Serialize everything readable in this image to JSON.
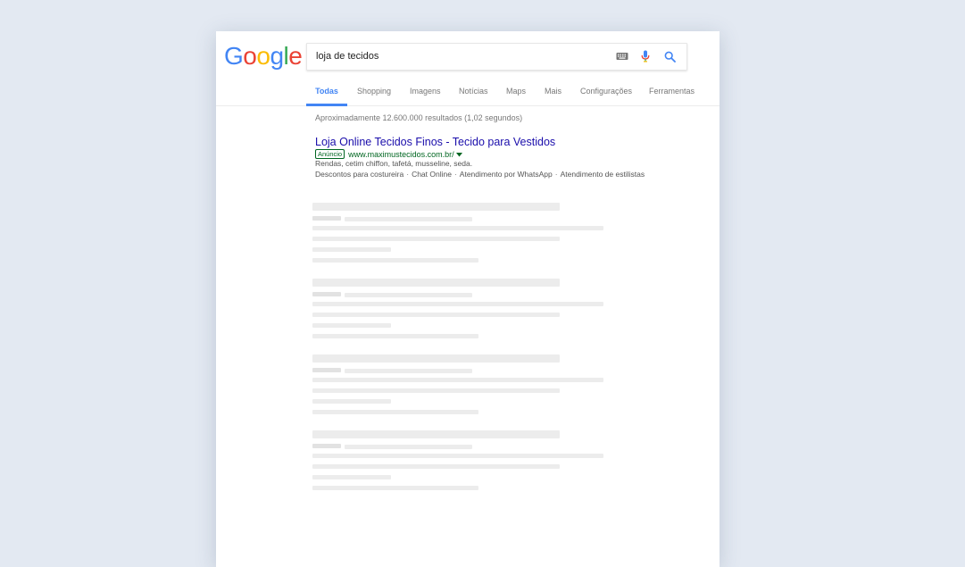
{
  "search": {
    "query": "loja de tecidos",
    "logo_letters": [
      "G",
      "o",
      "o",
      "g",
      "l",
      "e"
    ]
  },
  "tabs": [
    {
      "label": "Todas",
      "active": true
    },
    {
      "label": "Shopping",
      "active": false
    },
    {
      "label": "Imagens",
      "active": false
    },
    {
      "label": "Notícias",
      "active": false
    },
    {
      "label": "Maps",
      "active": false
    },
    {
      "label": "Mais",
      "active": false
    },
    {
      "label": "Configurações",
      "active": false
    },
    {
      "label": "Ferramentas",
      "active": false
    }
  ],
  "stats": "Aproximadamente 12.600.000 resultados (1,02 segundos)",
  "ad": {
    "title": "Loja Online Tecidos Finos - Tecido para Vestidos",
    "badge": "Anúncio",
    "url": "www.maximustecidos.com.br/",
    "description": "Rendas, cetim chiffon, tafetá, musseline, seda.",
    "sitelinks": [
      "Descontos para costureira",
      "Chat Online",
      "Atendimento por WhatsApp",
      "Atendimento de estilistas"
    ]
  },
  "icons": [
    "keyboard-icon",
    "microphone-icon",
    "search-icon",
    "dropdown-arrow-icon"
  ],
  "colors": {
    "link": "#1a0dab",
    "url": "#006621",
    "accent": "#4285f4",
    "skeleton": "#ececec"
  },
  "placeholder_results": 4
}
